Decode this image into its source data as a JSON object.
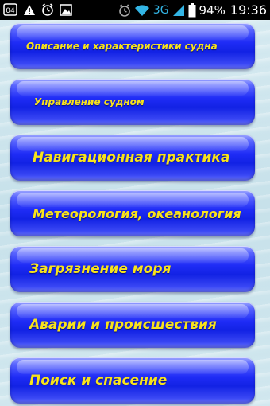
{
  "status_bar": {
    "network": "3G",
    "battery_percent": "94%",
    "time": "19:36",
    "left_icons": [
      "sim-icon",
      "warning-icon",
      "alarm-icon",
      "image-icon"
    ],
    "right_icons": [
      "alarm-icon",
      "wifi-icon",
      "signal-icon",
      "battery-icon"
    ],
    "network_color": "#33b5e5"
  },
  "menu": {
    "items": [
      {
        "label": "Описание и характеристики судна"
      },
      {
        "label": "Управление судном"
      },
      {
        "label": "Навигационная практика"
      },
      {
        "label": "Метеорология, океанология"
      },
      {
        "label": "Загрязнение моря"
      },
      {
        "label": "Аварии и происшествия"
      },
      {
        "label": "Поиск и спасение"
      }
    ],
    "button_color": "#1f2cf6",
    "label_color": "#f8e31c"
  }
}
